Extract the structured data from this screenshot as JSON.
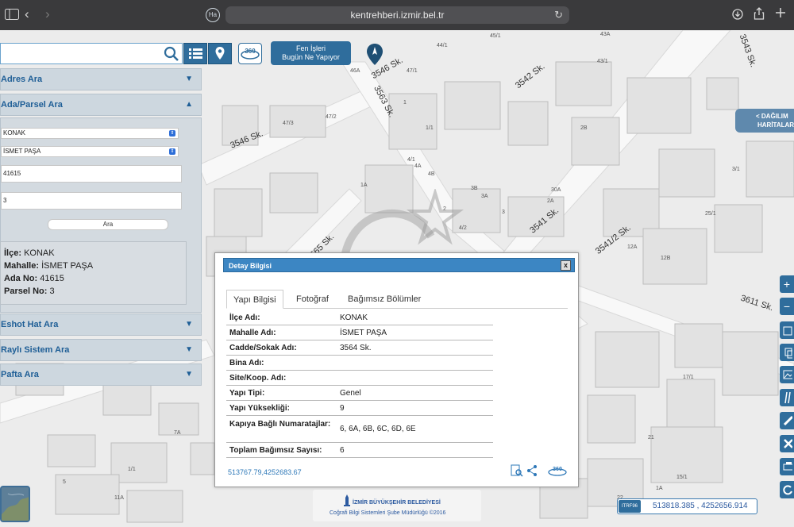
{
  "browser": {
    "url": "kentrehberi.izmir.bel.tr",
    "back_glyph": "‹",
    "forward_glyph": "›",
    "reload_glyph": "↻",
    "tab_icon_text": "Ha",
    "icons": [
      "sidebar-icon",
      "download-icon",
      "share-icon",
      "add-tab-icon"
    ]
  },
  "toolbar": {
    "fen_button": [
      "Fen İşleri",
      "Bugün Ne Yapıyor"
    ],
    "view360": "360"
  },
  "left_panel": {
    "accordions": [
      {
        "label": "Adres Ara",
        "expanded": false
      },
      {
        "label": "Ada/Parsel Ara",
        "expanded": true
      },
      {
        "label": "Eshot Hat Ara",
        "expanded": false
      },
      {
        "label": "Raylı Sistem Ara",
        "expanded": false
      },
      {
        "label": "Pafta Ara",
        "expanded": false
      }
    ],
    "ilce_select": "KONAK",
    "mahalle_select": "İSMET PAŞA",
    "ada_input": "41615",
    "parsel_input": "3",
    "search_button": "Ara",
    "result": {
      "ilce_label": "İlçe:",
      "ilce_value": "KONAK",
      "mahalle_label": "Mahalle:",
      "mahalle_value": "İSMET PAŞA",
      "ada_label": "Ada No:",
      "ada_value": "41615",
      "parsel_label": "Parsel No:",
      "parsel_value": "3"
    }
  },
  "dialog": {
    "title": "Detay Bilgisi",
    "close": "x",
    "tabs": [
      "Yapı Bilgisi",
      "Fotoğraf",
      "Bağımsız Bölümler"
    ],
    "active_tab": 0,
    "rows": [
      {
        "key": "İlçe Adı:",
        "value": "KONAK"
      },
      {
        "key": "Mahalle Adı:",
        "value": "İSMET PAŞA"
      },
      {
        "key": "Cadde/Sokak Adı:",
        "value": "3564 Sk."
      },
      {
        "key": "Bina Adı:",
        "value": ""
      },
      {
        "key": "Site/Koop. Adı:",
        "value": ""
      },
      {
        "key": "Yapı Tipi:",
        "value": "Genel"
      },
      {
        "key": "Yapı Yüksekliği:",
        "value": "9"
      },
      {
        "key": "Kapıya Bağlı Numaratajlar:",
        "value": "6, 6A, 6B, 6C, 6D, 6E"
      },
      {
        "key": "Toplam Bağımsız Sayısı:",
        "value": "6"
      }
    ],
    "coordinates": "513767.79,4252683.67",
    "footer_icons": [
      "zoom-doc-icon",
      "share-icon",
      "view-360-icon"
    ]
  },
  "map": {
    "streets": [
      "3546 Sk.",
      "3563 Sk.",
      "3542 Sk.",
      "3546 Sk.",
      "3565 Sk.",
      "3541 Sk.",
      "3541/2 Sk.",
      "3611 Sk.",
      "3543 Sk."
    ],
    "parcel_labels": [
      "45/1",
      "43A",
      "44/1",
      "43/1",
      "44",
      "46A",
      "47/1",
      "47/3",
      "47/2",
      "1/1",
      "2B",
      "1",
      "4/1",
      "4A",
      "4B",
      "3B",
      "3A",
      "30A",
      "2A",
      "3/1",
      "25/1",
      "12A",
      "12B",
      "4/2",
      "2",
      "1A",
      "3",
      "17/1",
      "15/1",
      "21",
      "7A",
      "1/1",
      "11A",
      "5",
      "22",
      "1A"
    ],
    "right_panel": [
      "< DAĞILIM",
      "HARİTALAR"
    ]
  },
  "right_toolbar": [
    "+",
    "−",
    "layers-icon",
    "copy-icon",
    "image-icon",
    "ruler-icon",
    "pencil-icon",
    "close-icon",
    "print-icon",
    "refresh-icon"
  ],
  "footer": {
    "logo_line1": "İZMİR BÜYÜKŞEHİR BELEDİYESİ",
    "logo_line2": "Coğrafi Bilgi Sistemleri Şube Müdürlüğü ©2016",
    "coord_label": "ITRF96",
    "coord_value": "513818.385 , 4252656.914"
  },
  "colors": {
    "accent": "#2f6d9c",
    "dialog_header": "#3c86c3",
    "panel_bg": "#d3dae0",
    "link": "#2e78b8"
  }
}
